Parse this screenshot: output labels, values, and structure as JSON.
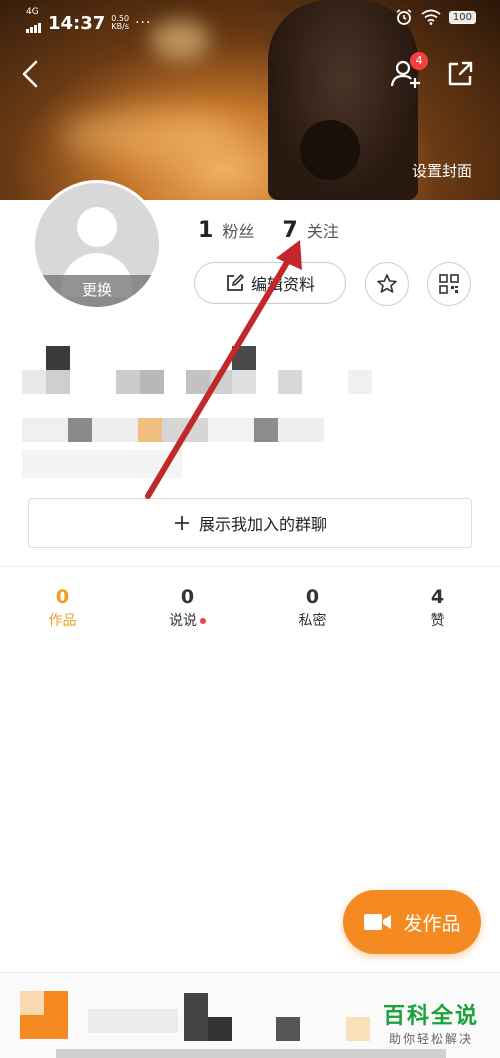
{
  "status_bar": {
    "network": "4G",
    "time": "14:37",
    "speed_value": "0.50",
    "speed_unit": "KB/s",
    "more": "···",
    "battery": "100"
  },
  "cover": {
    "set_cover_label": "设置封面",
    "friend_requests_badge": "4"
  },
  "profile": {
    "avatar_change_label": "更换",
    "fans_count": "1",
    "fans_label": "粉丝",
    "following_count": "7",
    "following_label": "关注",
    "edit_profile_label": "编辑资料",
    "show_groups_label": "展示我加入的群聊"
  },
  "tabs": [
    {
      "count": "0",
      "label": "作品",
      "active": true
    },
    {
      "count": "0",
      "label": "说说",
      "dot": true
    },
    {
      "count": "0",
      "label": "私密"
    },
    {
      "count": "4",
      "label": "赞"
    }
  ],
  "fab": {
    "label": "发作品"
  },
  "watermark": {
    "title": "百科全说",
    "subtitle": "助你轻松解决"
  },
  "colors": {
    "accent": "#f39c1f",
    "fab": "#f58a22",
    "arrow": "#c0282a",
    "watermark": "#1aa33a"
  }
}
